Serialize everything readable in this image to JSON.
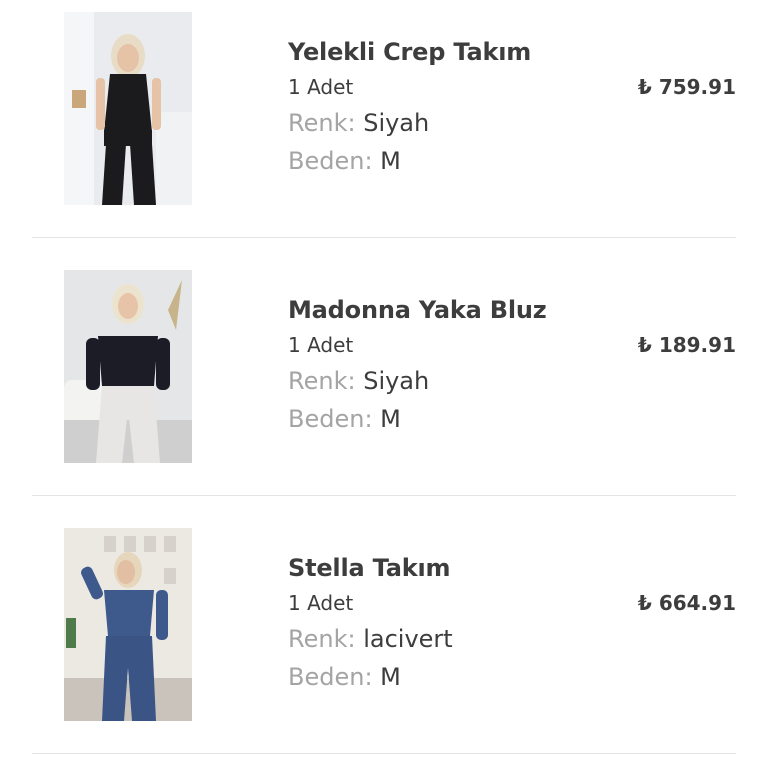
{
  "currency_symbol": "₺",
  "items": [
    {
      "name": "Yelekli Crep Takım",
      "quantity": "1 Adet",
      "color_label": "Renk:",
      "color_value": "Siyah",
      "size_label": "Beden:",
      "size_value": "M",
      "price": "759.91",
      "image_icon": "product-photo-black-vest-suit"
    },
    {
      "name": "Madonna Yaka Bluz",
      "quantity": "1 Adet",
      "color_label": "Renk:",
      "color_value": "Siyah",
      "size_label": "Beden:",
      "size_value": "M",
      "price": "189.91",
      "image_icon": "product-photo-off-shoulder-blouse"
    },
    {
      "name": "Stella Takım",
      "quantity": "1 Adet",
      "color_label": "Renk:",
      "color_value": "lacivert",
      "size_label": "Beden:",
      "size_value": "M",
      "price": "664.91",
      "image_icon": "product-photo-navy-set"
    }
  ],
  "colors": {
    "text_primary": "#3d3d3d",
    "text_muted": "#a4a4a4",
    "divider": "#e4e4e4"
  }
}
